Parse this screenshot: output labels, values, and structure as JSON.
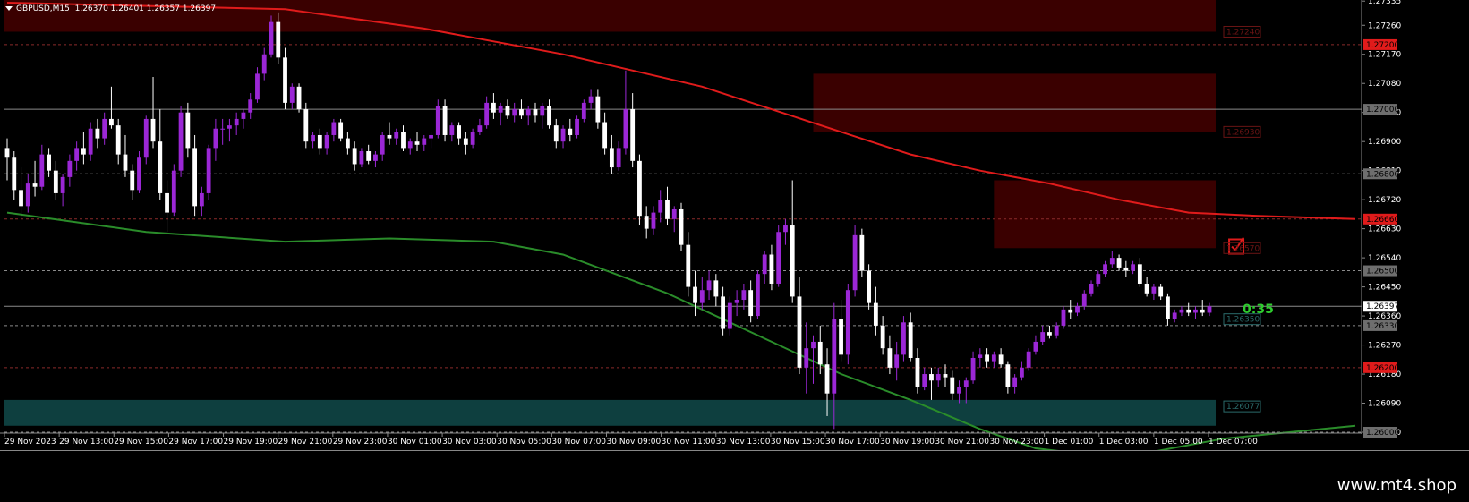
{
  "window": {
    "symbol_line": "GBPUSD,M15  1.26370 1.26401 1.26357 1.26397",
    "countdown": "0:35",
    "watermark": "www.mt4.shop"
  },
  "colors": {
    "bull": "#9b27d6",
    "bear": "#ffffff",
    "ma_red": "#e01b1b",
    "ma_green": "#2a8c2a",
    "supply_zone": "#3a0000",
    "demand_zone": "#0e3f3f",
    "level_red": "#e01b1b",
    "level_gray": "#9a9a9a"
  },
  "chart_data": {
    "type": "candlestick",
    "symbol": "GBPUSD",
    "timeframe": "M15",
    "ylim": [
      1.26,
      1.2733
    ],
    "y_ticks": [
      "1.27335",
      "1.27260",
      "1.27170",
      "1.27080",
      "1.26990",
      "1.26900",
      "1.26810",
      "1.26720",
      "1.26630",
      "1.26540",
      "1.26450",
      "1.26360",
      "1.26270",
      "1.26180",
      "1.26090",
      "1.26000"
    ],
    "x_labels": [
      "29 Nov 2023",
      "29 Nov 13:00",
      "29 Nov 15:00",
      "29 Nov 17:00",
      "29 Nov 19:00",
      "29 Nov 21:00",
      "29 Nov 23:00",
      "30 Nov 01:00",
      "30 Nov 03:00",
      "30 Nov 05:00",
      "30 Nov 07:00",
      "30 Nov 09:00",
      "30 Nov 11:00",
      "30 Nov 13:00",
      "30 Nov 15:00",
      "30 Nov 17:00",
      "30 Nov 19:00",
      "30 Nov 21:00",
      "30 Nov 23:00",
      "1 Dec 01:00",
      "1 Dec 03:00",
      "1 Dec 05:00",
      "1 Dec 07:00"
    ],
    "price_levels": [
      {
        "price": 1.272,
        "label": "1.27200",
        "style": "red"
      },
      {
        "price": 1.27,
        "label": "1.27000",
        "style": "solid-gray"
      },
      {
        "price": 1.268,
        "label": "1.26800",
        "style": "gray"
      },
      {
        "price": 1.2666,
        "label": "1.26660",
        "style": "red"
      },
      {
        "price": 1.265,
        "label": "1.26500",
        "style": "gray"
      },
      {
        "price": 1.2639,
        "label": "1.26397",
        "style": "current"
      },
      {
        "price": 1.2633,
        "label": "1.26330",
        "style": "gray"
      },
      {
        "price": 1.262,
        "label": "1.26200",
        "style": "red"
      },
      {
        "price": 1.26,
        "label": "1.26000",
        "style": "gray"
      }
    ],
    "zone_labels": [
      {
        "price": 1.2724,
        "label": "1.27240",
        "kind": "supply"
      },
      {
        "price": 1.2693,
        "label": "1.26930",
        "kind": "supply"
      },
      {
        "price": 1.2657,
        "label": "1.26570",
        "kind": "supply"
      },
      {
        "price": 1.2635,
        "label": "1.26350",
        "kind": "demand"
      },
      {
        "price": 1.2608,
        "label": "1.26077",
        "kind": "demand"
      }
    ],
    "zones": [
      {
        "kind": "supply",
        "top": 1.2735,
        "bottom": 1.2724,
        "from_bar": 0
      },
      {
        "kind": "supply",
        "top": 1.2711,
        "bottom": 1.2693,
        "from_bar": 116
      },
      {
        "kind": "supply",
        "top": 1.2678,
        "bottom": 1.2657,
        "from_bar": 142
      },
      {
        "kind": "demand",
        "top": 1.261,
        "bottom": 1.2602,
        "from_bar": 0
      },
      {
        "kind": "demand",
        "top": 1.2635,
        "bottom": 1.2633,
        "from_bar": 213
      }
    ],
    "bars": [
      [
        1.2688,
        1.2691,
        1.2678,
        1.2685
      ],
      [
        1.2685,
        1.2687,
        1.2672,
        1.2675
      ],
      [
        1.2675,
        1.2682,
        1.2666,
        1.267
      ],
      [
        1.267,
        1.268,
        1.2668,
        1.2677
      ],
      [
        1.2677,
        1.2684,
        1.2673,
        1.2676
      ],
      [
        1.2676,
        1.2689,
        1.2675,
        1.2686
      ],
      [
        1.2686,
        1.2688,
        1.2679,
        1.2681
      ],
      [
        1.2681,
        1.2684,
        1.2672,
        1.2674
      ],
      [
        1.2674,
        1.268,
        1.267,
        1.2679
      ],
      [
        1.2679,
        1.2686,
        1.2676,
        1.2684
      ],
      [
        1.2684,
        1.269,
        1.2681,
        1.2688
      ],
      [
        1.2688,
        1.2693,
        1.2683,
        1.2686
      ],
      [
        1.2686,
        1.2696,
        1.2684,
        1.2694
      ],
      [
        1.2694,
        1.2697,
        1.2688,
        1.2691
      ],
      [
        1.2691,
        1.2699,
        1.2689,
        1.2697
      ],
      [
        1.2697,
        1.2707,
        1.2694,
        1.2695
      ],
      [
        1.2695,
        1.2697,
        1.2683,
        1.2686
      ],
      [
        1.2686,
        1.2692,
        1.2679,
        1.2681
      ],
      [
        1.2681,
        1.2683,
        1.2672,
        1.2675
      ],
      [
        1.2675,
        1.2687,
        1.2674,
        1.2685
      ],
      [
        1.2685,
        1.2698,
        1.2683,
        1.2697
      ],
      [
        1.2697,
        1.271,
        1.2688,
        1.269
      ],
      [
        1.269,
        1.27,
        1.2672,
        1.2674
      ],
      [
        1.2674,
        1.2678,
        1.2662,
        1.2668
      ],
      [
        1.2668,
        1.2683,
        1.2667,
        1.2681
      ],
      [
        1.2681,
        1.2701,
        1.2679,
        1.2699
      ],
      [
        1.2699,
        1.2702,
        1.2685,
        1.2688
      ],
      [
        1.2688,
        1.2692,
        1.2667,
        1.267
      ],
      [
        1.267,
        1.2676,
        1.2667,
        1.2674
      ],
      [
        1.2674,
        1.2689,
        1.2672,
        1.2688
      ],
      [
        1.2688,
        1.2697,
        1.2684,
        1.2694
      ],
      [
        1.2694,
        1.2697,
        1.2689,
        1.2694
      ],
      [
        1.2694,
        1.2697,
        1.269,
        1.2695
      ],
      [
        1.2695,
        1.2699,
        1.2692,
        1.2697
      ],
      [
        1.2697,
        1.27,
        1.2694,
        1.2699
      ],
      [
        1.2699,
        1.2705,
        1.2697,
        1.2703
      ],
      [
        1.2703,
        1.2713,
        1.2702,
        1.2711
      ],
      [
        1.2711,
        1.2719,
        1.2709,
        1.2717
      ],
      [
        1.2717,
        1.2729,
        1.2716,
        1.2727
      ],
      [
        1.2727,
        1.273,
        1.2714,
        1.2716
      ],
      [
        1.2716,
        1.2719,
        1.27,
        1.2702
      ],
      [
        1.2702,
        1.2708,
        1.27,
        1.2707
      ],
      [
        1.2707,
        1.2708,
        1.2699,
        1.27
      ],
      [
        1.27,
        1.2702,
        1.2688,
        1.269
      ],
      [
        1.269,
        1.2693,
        1.2688,
        1.2692
      ],
      [
        1.2692,
        1.2694,
        1.2686,
        1.2688
      ],
      [
        1.2688,
        1.2693,
        1.2686,
        1.2692
      ],
      [
        1.2692,
        1.2697,
        1.269,
        1.2696
      ],
      [
        1.2696,
        1.2697,
        1.269,
        1.2691
      ],
      [
        1.2691,
        1.2693,
        1.2686,
        1.2688
      ],
      [
        1.2688,
        1.269,
        1.2681,
        1.2683
      ],
      [
        1.2683,
        1.2688,
        1.2682,
        1.2687
      ],
      [
        1.2687,
        1.2689,
        1.2683,
        1.2684
      ],
      [
        1.2684,
        1.2687,
        1.2682,
        1.2686
      ],
      [
        1.2686,
        1.2693,
        1.2684,
        1.2692
      ],
      [
        1.2692,
        1.2696,
        1.2689,
        1.2691
      ],
      [
        1.2691,
        1.2694,
        1.2689,
        1.2693
      ],
      [
        1.2693,
        1.2695,
        1.2687,
        1.2688
      ],
      [
        1.2688,
        1.2691,
        1.2686,
        1.269
      ],
      [
        1.269,
        1.2693,
        1.2687,
        1.2689
      ],
      [
        1.2689,
        1.2692,
        1.2687,
        1.2691
      ],
      [
        1.2691,
        1.2693,
        1.2688,
        1.2692
      ],
      [
        1.2692,
        1.2703,
        1.2691,
        1.2701
      ],
      [
        1.2701,
        1.2703,
        1.269,
        1.2692
      ],
      [
        1.2692,
        1.2696,
        1.269,
        1.2695
      ],
      [
        1.2695,
        1.2696,
        1.2689,
        1.2691
      ],
      [
        1.2691,
        1.2693,
        1.2686,
        1.2689
      ],
      [
        1.2689,
        1.2694,
        1.2688,
        1.2693
      ],
      [
        1.2693,
        1.2697,
        1.2692,
        1.2695
      ],
      [
        1.2695,
        1.2704,
        1.2694,
        1.2702
      ],
      [
        1.2702,
        1.2705,
        1.2697,
        1.2699
      ],
      [
        1.2699,
        1.2702,
        1.2695,
        1.2701
      ],
      [
        1.2701,
        1.2703,
        1.2697,
        1.2698
      ],
      [
        1.2698,
        1.2702,
        1.2696,
        1.27
      ],
      [
        1.27,
        1.2703,
        1.2697,
        1.2698
      ],
      [
        1.2698,
        1.2701,
        1.2695,
        1.27
      ],
      [
        1.27,
        1.2702,
        1.2696,
        1.2698
      ],
      [
        1.2698,
        1.2702,
        1.2694,
        1.2701
      ],
      [
        1.2701,
        1.2703,
        1.2694,
        1.2695
      ],
      [
        1.2695,
        1.2697,
        1.2688,
        1.269
      ],
      [
        1.269,
        1.2695,
        1.2688,
        1.2694
      ],
      [
        1.2694,
        1.2697,
        1.269,
        1.2692
      ],
      [
        1.2692,
        1.2698,
        1.2691,
        1.2697
      ],
      [
        1.2697,
        1.2703,
        1.2696,
        1.2702
      ],
      [
        1.2702,
        1.2706,
        1.27,
        1.2704
      ],
      [
        1.2704,
        1.2706,
        1.2694,
        1.2696
      ],
      [
        1.2696,
        1.2699,
        1.2686,
        1.2688
      ],
      [
        1.2688,
        1.2692,
        1.268,
        1.2682
      ],
      [
        1.2682,
        1.269,
        1.2681,
        1.2688
      ],
      [
        1.2688,
        1.2712,
        1.2686,
        1.27
      ],
      [
        1.27,
        1.2705,
        1.2682,
        1.2684
      ],
      [
        1.2684,
        1.2686,
        1.2664,
        1.2667
      ],
      [
        1.2667,
        1.267,
        1.266,
        1.2663
      ],
      [
        1.2663,
        1.267,
        1.2661,
        1.2668
      ],
      [
        1.2668,
        1.2675,
        1.2665,
        1.2672
      ],
      [
        1.2672,
        1.2676,
        1.2664,
        1.2666
      ],
      [
        1.2666,
        1.267,
        1.2662,
        1.2669
      ],
      [
        1.2669,
        1.2671,
        1.2656,
        1.2658
      ],
      [
        1.2658,
        1.2662,
        1.2642,
        1.2645
      ],
      [
        1.2645,
        1.265,
        1.2636,
        1.264
      ],
      [
        1.264,
        1.2648,
        1.2638,
        1.2644
      ],
      [
        1.2644,
        1.265,
        1.2641,
        1.2647
      ],
      [
        1.2647,
        1.2649,
        1.2639,
        1.2642
      ],
      [
        1.2642,
        1.2645,
        1.263,
        1.2632
      ],
      [
        1.2632,
        1.2642,
        1.263,
        1.264
      ],
      [
        1.264,
        1.2644,
        1.2636,
        1.2641
      ],
      [
        1.2641,
        1.2646,
        1.2638,
        1.2644
      ],
      [
        1.2644,
        1.2647,
        1.2634,
        1.2636
      ],
      [
        1.2636,
        1.265,
        1.2635,
        1.2649
      ],
      [
        1.2649,
        1.2656,
        1.2646,
        1.2655
      ],
      [
        1.2655,
        1.2658,
        1.2644,
        1.2646
      ],
      [
        1.2646,
        1.2664,
        1.2645,
        1.2662
      ],
      [
        1.2662,
        1.2666,
        1.2658,
        1.2664
      ],
      [
        1.2664,
        1.2678,
        1.264,
        1.2642
      ],
      [
        1.2642,
        1.2648,
        1.2618,
        1.262
      ],
      [
        1.262,
        1.2634,
        1.2612,
        1.2626
      ],
      [
        1.2626,
        1.263,
        1.2615,
        1.2628
      ],
      [
        1.2628,
        1.2633,
        1.2618,
        1.2621
      ],
      [
        1.2621,
        1.2626,
        1.2605,
        1.2612
      ],
      [
        1.2612,
        1.264,
        1.2601,
        1.2635
      ],
      [
        1.2635,
        1.2641,
        1.2622,
        1.2624
      ],
      [
        1.2624,
        1.2646,
        1.2621,
        1.2644
      ],
      [
        1.2644,
        1.2664,
        1.2642,
        1.2661
      ],
      [
        1.2661,
        1.2663,
        1.2648,
        1.265
      ],
      [
        1.265,
        1.2652,
        1.2638,
        1.264
      ],
      [
        1.264,
        1.2645,
        1.263,
        1.2633
      ],
      [
        1.2633,
        1.2636,
        1.2624,
        1.2626
      ],
      [
        1.2626,
        1.263,
        1.2618,
        1.262
      ],
      [
        1.262,
        1.2628,
        1.2616,
        1.2624
      ],
      [
        1.2624,
        1.2636,
        1.2622,
        1.2634
      ],
      [
        1.2634,
        1.2637,
        1.2622,
        1.2623
      ],
      [
        1.2623,
        1.2626,
        1.2612,
        1.2614
      ],
      [
        1.2614,
        1.262,
        1.2613,
        1.2618
      ],
      [
        1.2618,
        1.262,
        1.261,
        1.2616
      ],
      [
        1.2616,
        1.262,
        1.2614,
        1.2618
      ],
      [
        1.2618,
        1.2621,
        1.2614,
        1.2617
      ],
      [
        1.2617,
        1.2619,
        1.261,
        1.2612
      ],
      [
        1.2612,
        1.2616,
        1.2609,
        1.2614
      ],
      [
        1.2614,
        1.2617,
        1.2609,
        1.2616
      ],
      [
        1.2616,
        1.2625,
        1.2615,
        1.2623
      ],
      [
        1.2623,
        1.2626,
        1.262,
        1.2624
      ],
      [
        1.2624,
        1.2626,
        1.262,
        1.2622
      ],
      [
        1.2622,
        1.2625,
        1.262,
        1.2624
      ],
      [
        1.2624,
        1.2626,
        1.262,
        1.2621
      ],
      [
        1.2621,
        1.2622,
        1.2612,
        1.2614
      ],
      [
        1.2614,
        1.2618,
        1.2612,
        1.2617
      ],
      [
        1.2617,
        1.2622,
        1.2616,
        1.262
      ],
      [
        1.262,
        1.2626,
        1.2619,
        1.2625
      ],
      [
        1.2625,
        1.263,
        1.2624,
        1.2628
      ],
      [
        1.2628,
        1.2633,
        1.2627,
        1.2631
      ],
      [
        1.2631,
        1.2633,
        1.2629,
        1.263
      ],
      [
        1.263,
        1.2634,
        1.2629,
        1.2633
      ],
      [
        1.2633,
        1.2639,
        1.2632,
        1.2638
      ],
      [
        1.2638,
        1.2641,
        1.2635,
        1.2637
      ],
      [
        1.2637,
        1.264,
        1.2636,
        1.2639
      ],
      [
        1.2639,
        1.2644,
        1.2638,
        1.2643
      ],
      [
        1.2643,
        1.2647,
        1.2642,
        1.2646
      ],
      [
        1.2646,
        1.265,
        1.2645,
        1.2649
      ],
      [
        1.2649,
        1.2653,
        1.2648,
        1.2652
      ],
      [
        1.2652,
        1.2656,
        1.2651,
        1.2654
      ],
      [
        1.2654,
        1.2655,
        1.265,
        1.2651
      ],
      [
        1.2651,
        1.2653,
        1.2648,
        1.265
      ],
      [
        1.265,
        1.2653,
        1.2649,
        1.2652
      ],
      [
        1.2652,
        1.2654,
        1.2645,
        1.2646
      ],
      [
        1.2646,
        1.2648,
        1.2642,
        1.2643
      ],
      [
        1.2643,
        1.2646,
        1.2641,
        1.2645
      ],
      [
        1.2645,
        1.2646,
        1.2641,
        1.2642
      ],
      [
        1.2642,
        1.2643,
        1.2633,
        1.2635
      ],
      [
        1.2635,
        1.2638,
        1.2634,
        1.2637
      ],
      [
        1.2637,
        1.2639,
        1.2636,
        1.2638
      ],
      [
        1.2638,
        1.264,
        1.2636,
        1.2637
      ],
      [
        1.2637,
        1.2639,
        1.2635,
        1.2638
      ],
      [
        1.2638,
        1.2641,
        1.2636,
        1.2637
      ],
      [
        1.2637,
        1.264,
        1.2636,
        1.2639
      ]
    ],
    "ma_red": [
      [
        0,
        1.2733
      ],
      [
        40,
        1.2731
      ],
      [
        60,
        1.2725
      ],
      [
        80,
        1.2717
      ],
      [
        100,
        1.2707
      ],
      [
        120,
        1.2693
      ],
      [
        130,
        1.2686
      ],
      [
        140,
        1.2681
      ],
      [
        150,
        1.2677
      ],
      [
        160,
        1.2672
      ],
      [
        170,
        1.2668
      ],
      [
        180,
        1.2667
      ],
      [
        194,
        1.2666
      ]
    ],
    "ma_green": [
      [
        0,
        1.2668
      ],
      [
        20,
        1.2662
      ],
      [
        40,
        1.2659
      ],
      [
        55,
        1.266
      ],
      [
        70,
        1.2659
      ],
      [
        80,
        1.2655
      ],
      [
        95,
        1.2643
      ],
      [
        110,
        1.2628
      ],
      [
        120,
        1.2618
      ],
      [
        130,
        1.261
      ],
      [
        140,
        1.2601
      ],
      [
        148,
        1.2595
      ],
      [
        160,
        1.2592
      ],
      [
        175,
        1.2598
      ],
      [
        194,
        1.2602
      ]
    ],
    "signal_marker": {
      "bar": 177,
      "price": 1.2655,
      "icon": "check-box-icon"
    }
  }
}
